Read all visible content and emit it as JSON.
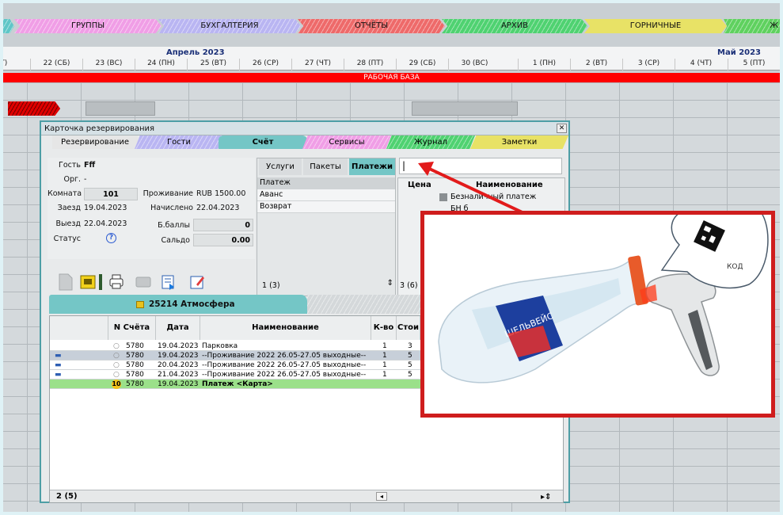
{
  "modules": [
    {
      "label": "",
      "color": "#5fc6c7"
    },
    {
      "label": "ГРУППЫ",
      "color": "#f09ee6"
    },
    {
      "label": "БУХГАЛТЕРИЯ",
      "color": "#b9b5f2"
    },
    {
      "label": "ОТЧЁТЫ",
      "color": "#ee6a6a"
    },
    {
      "label": "АРХИВ",
      "color": "#4fd271"
    },
    {
      "label": "ГОРНИЧНЫЕ",
      "color": "#e8e266"
    },
    {
      "label": "Ж",
      "color": "#5fd15f"
    }
  ],
  "calendar": {
    "month_april": "Апрель 2023",
    "month_may": "Май 2023",
    "days": [
      "IT)",
      "22 (СБ)",
      "23 (ВС)",
      "24 (ПН)",
      "25 (ВТ)",
      "26 (СР)",
      "27 (ЧТ)",
      "28 (ПТ)",
      "29 (СБ)",
      "30 (ВС)",
      "1 (ПН)",
      "2 (ВТ)",
      "3 (СР)",
      "4 (ЧТ)",
      "5 (ПТ)"
    ],
    "base_label": "РАБОЧАЯ БАЗА"
  },
  "dialog": {
    "title": "Карточка резервирования",
    "close": "✕",
    "tabs": [
      {
        "label": "Резервирование",
        "color": "#e6e6e6"
      },
      {
        "label": "Гости",
        "color": "#b9b5f2"
      },
      {
        "label": "Счёт",
        "color": "#74c6c6"
      },
      {
        "label": "Сервисы",
        "color": "#f09ee6"
      },
      {
        "label": "Журнал",
        "color": "#4fd271"
      },
      {
        "label": "Заметки",
        "color": "#e8e266"
      }
    ],
    "info": {
      "guest_label": "Гость",
      "guest_value": "Fff",
      "org_label": "Орг.",
      "org_value": "-",
      "room_label": "Комната",
      "room_value": "101",
      "checkin_label": "Заезд",
      "checkin_value": "19.04.2023",
      "checkout_label": "Выезд",
      "checkout_value": "22.04.2023",
      "status_label": "Статус",
      "status_value": "?",
      "stay_label": "Проживание",
      "stay_value": "RUB 1500.00",
      "charged_label": "Начислено",
      "charged_value": "22.04.2023",
      "bonus_label": "Б.баллы",
      "bonus_value": "0",
      "balance_label": "Сальдо",
      "balance_value": "0.00"
    },
    "pay_tabs": [
      "Услуги",
      "Пакеты",
      "Платежи"
    ],
    "pay_rows": [
      "Платеж",
      "Аванс",
      "Возврат"
    ],
    "pay_count": "1 (3)",
    "input_value": "|",
    "rpanel": {
      "col_price": "Цена",
      "col_name": "Наименование",
      "row1": "Безналичный платеж",
      "row2": "БН б",
      "count": "3 (6)"
    },
    "account": {
      "title": "25214  Атмосфера",
      "headers": [
        "N Счёта",
        "Дата",
        "Наименование",
        "К-во",
        "Стои"
      ],
      "rows": [
        {
          "num": "5780",
          "date": "19.04.2023",
          "name": "Парковка",
          "qty": "1",
          "cost": "3"
        },
        {
          "num": "5780",
          "date": "19.04.2023",
          "name": "--Проживание 2022 26.05-27.05 выходные--",
          "qty": "1",
          "cost": "5"
        },
        {
          "num": "5780",
          "date": "20.04.2023",
          "name": "--Проживание 2022 26.05-27.05 выходные--",
          "qty": "1",
          "cost": "5"
        },
        {
          "num": "5780",
          "date": "21.04.2023",
          "name": "--Проживание 2022 26.05-27.05 выходные--",
          "qty": "1",
          "cost": "5"
        },
        {
          "num": "5780",
          "date": "19.04.2023",
          "name": "Платеж <Карта>",
          "qty": "",
          "cost": ""
        }
      ],
      "count": "2 (5)",
      "payment_badge": "10"
    }
  },
  "overlay": {
    "code_label": "КОД",
    "bottle_label": "ШЕЛЬВЕЙС",
    "border_color": "#cf1d1d"
  }
}
